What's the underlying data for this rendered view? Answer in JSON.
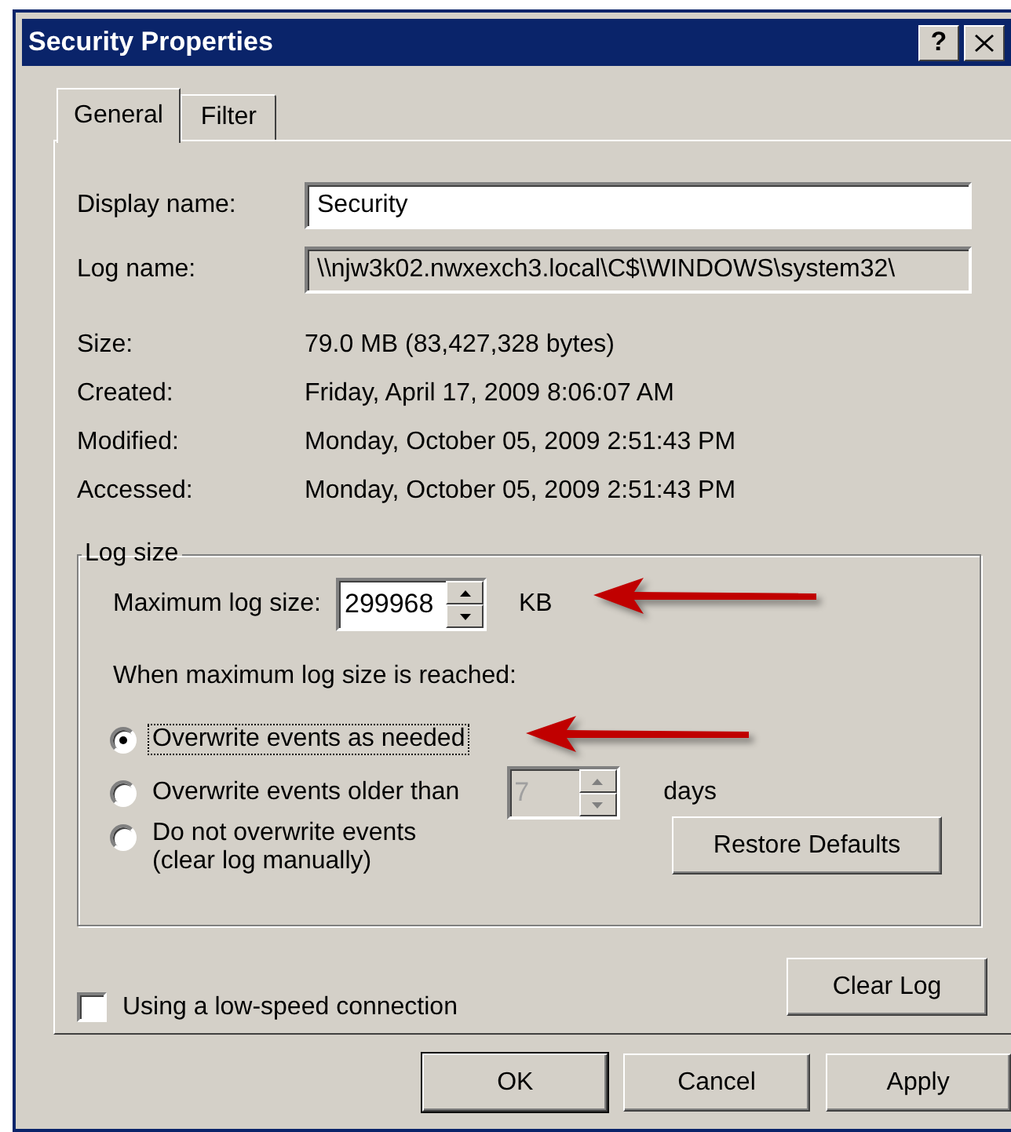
{
  "window": {
    "title": "Security Properties",
    "help_button": "?"
  },
  "tabs": [
    {
      "label": "General",
      "selected": true
    },
    {
      "label": "Filter",
      "selected": false
    }
  ],
  "fields": [
    {
      "label": "Display name:",
      "value": "Security",
      "read_only": false
    },
    {
      "label": "Log name:",
      "value": "\\\\njw3k02.nwxexch3.local\\C$\\WINDOWS\\system32\\",
      "read_only": true
    }
  ],
  "info": [
    {
      "label": "Size:",
      "value": "79.0 MB (83,427,328 bytes)"
    },
    {
      "label": "Created:",
      "value": "Friday, April 17, 2009 8:06:07 AM"
    },
    {
      "label": "Modified:",
      "value": "Monday, October 05, 2009 2:51:43 PM"
    },
    {
      "label": "Accessed:",
      "value": "Monday, October 05, 2009 2:51:43 PM"
    }
  ],
  "log_size": {
    "title": "Log size",
    "max_label": "Maximum log size:",
    "max_value": "299968",
    "unit": "KB",
    "prompt": "When maximum log size is reached:",
    "options": [
      {
        "kind": "plain",
        "label": "Overwrite events as needed",
        "selected": true,
        "focused": true
      },
      {
        "kind": "days",
        "label": "Overwrite events older than",
        "selected": false,
        "focused": false,
        "days_value": "7",
        "days_disabled": true,
        "days_unit": "days"
      },
      {
        "kind": "note",
        "label": "Do not overwrite events",
        "note": "(clear log manually)",
        "selected": false,
        "focused": false
      }
    ],
    "restore_button": "Restore Defaults"
  },
  "low_speed": {
    "label": "Using a low-speed connection",
    "checked": false
  },
  "clear_button": "Clear Log",
  "buttons": [
    {
      "label": "OK",
      "default": true
    },
    {
      "label": "Cancel",
      "default": false
    },
    {
      "label": "Apply",
      "default": false
    }
  ]
}
